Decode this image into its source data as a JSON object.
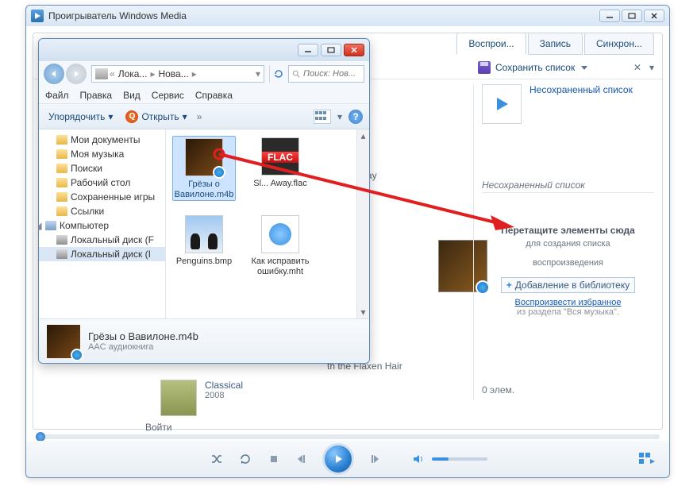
{
  "wmp": {
    "title": "Проигрыватель Windows Media",
    "tabs": {
      "play": "Воспрои...",
      "burn": "Запись",
      "sync": "Синхрон..."
    },
    "save_list": "Сохранить список",
    "playlist": {
      "title": "Несохраненный список",
      "label": "Несохраненный список",
      "drop_title": "Перетащите элементы сюда",
      "drop_sub1": "для создания списка",
      "drop_sub2": "воспроизведения",
      "adding": "Добавление в библиотеку",
      "play_fav": "Воспроизвести избранное",
      "fav_sub": "из раздела \"Вся музыка\".",
      "count": "0 элем."
    },
    "content": {
      "flaxen": "th the Flaxen Hair",
      "album_genre": "Classical",
      "album_year": "2008",
      "away": "ay"
    },
    "login": "Войти"
  },
  "explorer": {
    "breadcrumb": {
      "p1": "Лока...",
      "p2": "Нова..."
    },
    "search_placeholder": "Поиск: Нов...",
    "menu": {
      "file": "Файл",
      "edit": "Правка",
      "view": "Вид",
      "service": "Сервис",
      "help": "Справка"
    },
    "toolbar": {
      "organize": "Упорядочить",
      "open": "Открыть",
      "more": "»"
    },
    "tree": {
      "my_docs": "Мои документы",
      "my_music": "Моя музыка",
      "searches": "Поиски",
      "desktop": "Рабочий стол",
      "saved_games": "Сохраненные игры",
      "links": "Ссылки",
      "computer": "Компьютер",
      "disk_f": "Локальный диск (F",
      "disk_i": "Локальный диск (I"
    },
    "files": {
      "vavilon": "Грёзы о Вавилоне.m4b",
      "flac_name": "Sl... Away.flac",
      "flac_badge": "FLAC",
      "penguins": "Penguins.bmp",
      "mht": "Как исправить ошибку.mht"
    },
    "details": {
      "name": "Грёзы о Вавилоне.m4b",
      "type": "AAC аудиокнига"
    }
  }
}
